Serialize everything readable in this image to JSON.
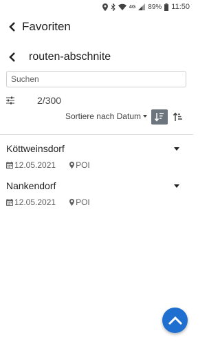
{
  "status_bar": {
    "network": "4G",
    "battery": "89%",
    "time": "11:50"
  },
  "header": {
    "title": "Favoriten"
  },
  "subheader": {
    "title": "routen-abschnite"
  },
  "search": {
    "placeholder": "Suchen",
    "value": ""
  },
  "filter": {
    "count": "2/300"
  },
  "sort": {
    "label": "Sortiere nach Datum"
  },
  "items": [
    {
      "title": "Köttweinsdorf",
      "date": "12.05.2021",
      "type": "POI"
    },
    {
      "title": "Nankendorf",
      "date": "12.05.2021",
      "type": "POI"
    }
  ],
  "colors": {
    "accent": "#1e6fd0",
    "sort_active": "#6c757d"
  },
  "icons": [
    "location-icon",
    "bluetooth-icon",
    "wifi-icon",
    "signal-icon",
    "battery-icon",
    "back-arrow-icon",
    "filter-icon",
    "sort-desc-icon",
    "sort-asc-icon",
    "calendar-icon",
    "map-marker-icon",
    "chevron-up-icon"
  ]
}
